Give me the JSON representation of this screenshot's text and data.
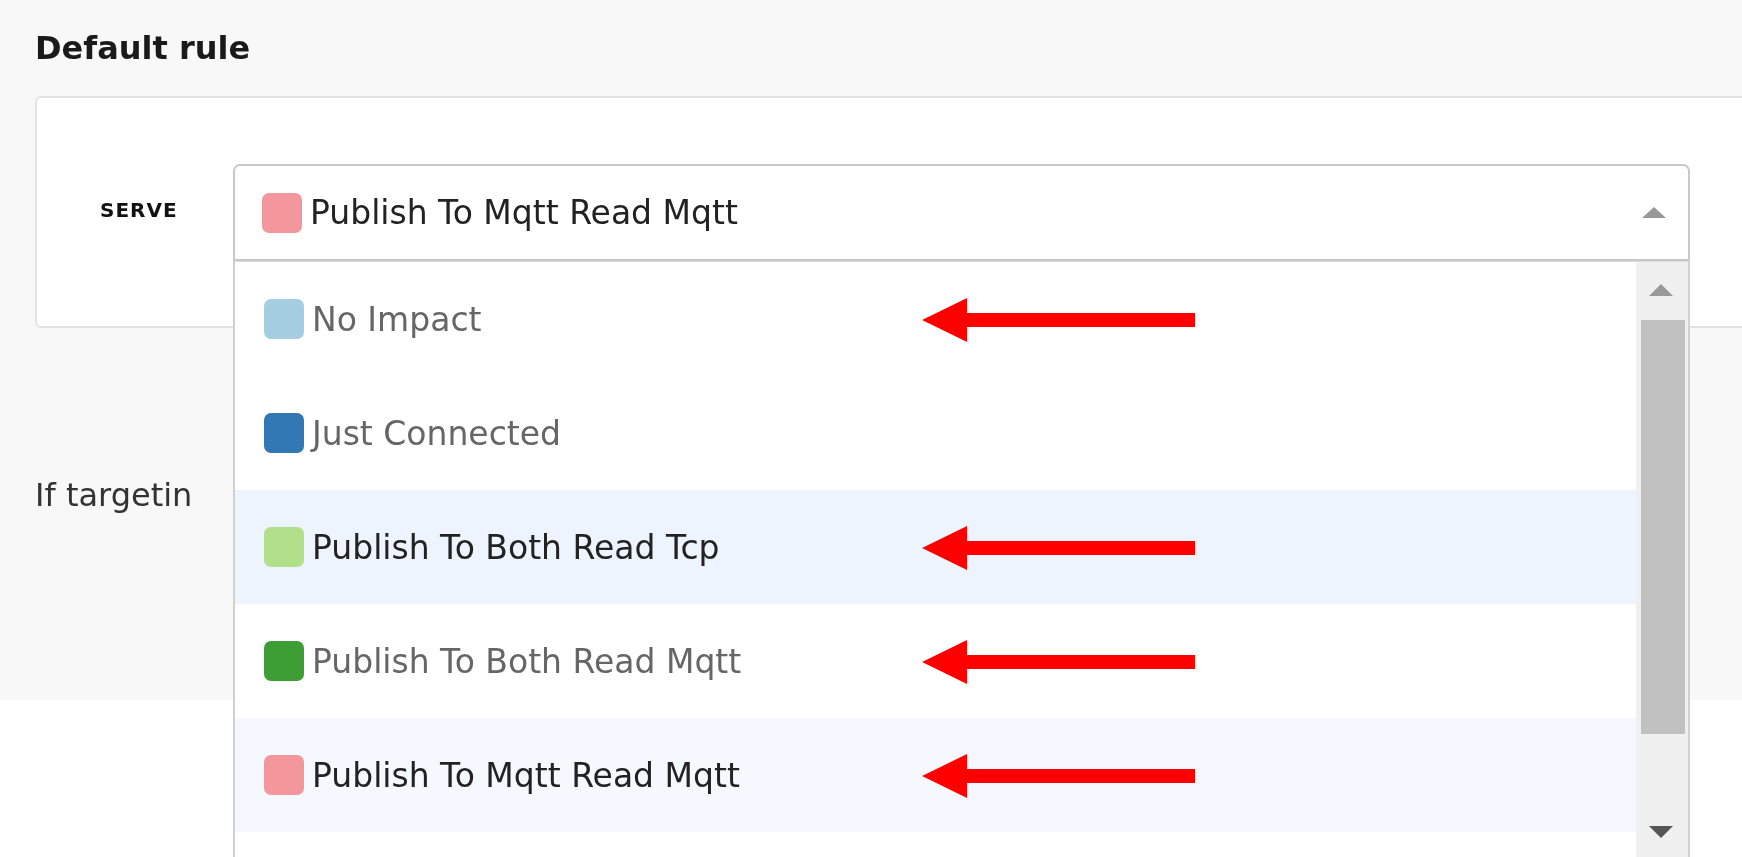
{
  "section": {
    "title": "Default rule"
  },
  "serve": {
    "label": "SERVE",
    "value": "Publish To Mqtt Read Mqtt",
    "color": "#f4979c",
    "expanded": true
  },
  "options": [
    {
      "label": "No Impact",
      "color": "#a6cee3",
      "highlighted": false,
      "selected": false,
      "arrow": true
    },
    {
      "label": "Just Connected",
      "color": "#3178b4",
      "highlighted": false,
      "selected": false,
      "arrow": false
    },
    {
      "label": "Publish To Both Read Tcp",
      "color": "#b2df8a",
      "highlighted": true,
      "selected": false,
      "arrow": true
    },
    {
      "label": "Publish To Both Read Mqtt",
      "color": "#3e9e36",
      "highlighted": false,
      "selected": false,
      "arrow": true
    },
    {
      "label": "Publish To Mqtt Read Mqtt",
      "color": "#f4979c",
      "highlighted": false,
      "selected": true,
      "arrow": true
    }
  ],
  "note": "If targetin"
}
